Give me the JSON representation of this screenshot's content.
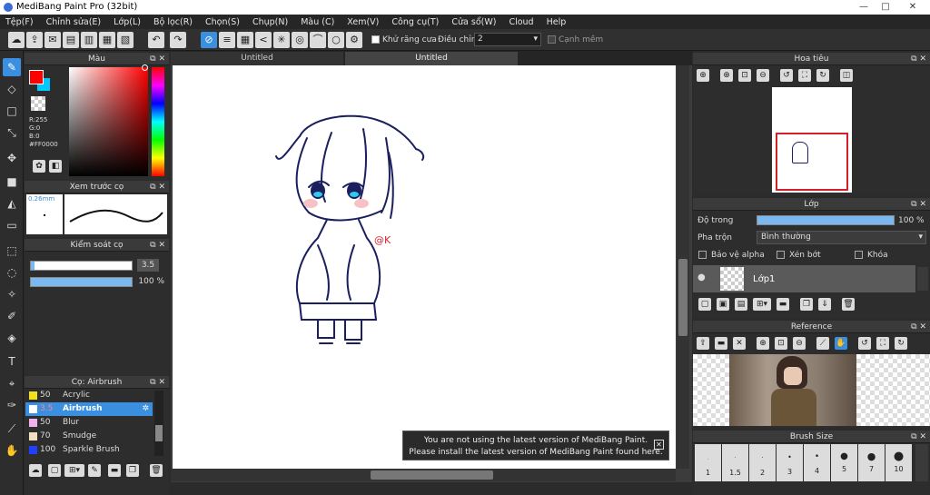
{
  "window": {
    "title": "MediBang Paint Pro (32bit)"
  },
  "menu": [
    "Tệp(F)",
    "Chỉnh sửa(E)",
    "Lớp(L)",
    "Bộ lọc(R)",
    "Chọn(S)",
    "Chụp(N)",
    "Màu (C)",
    "Xem(V)",
    "Công cụ(T)",
    "Cửa sổ(W)",
    "Cloud",
    "Help"
  ],
  "toolbar": {
    "antialias_label": "Khử răng cưa",
    "adjust_label": "Điều chỉnh",
    "adjust_value": "2",
    "smooth_label": "Cạnh mềm"
  },
  "color_panel": {
    "title": "Màu",
    "r": "R:255",
    "g": "G:0",
    "b": "B:0",
    "hex": "#FF0000",
    "primary": "#ff0000",
    "secondary": "#00c8ff"
  },
  "brush_preview": {
    "title": "Xem trước cọ",
    "size": "0.26mm"
  },
  "brush_control": {
    "title": "Kiểm soát cọ",
    "size_value": "3.5",
    "opacity_value": "100 %"
  },
  "brush_list": {
    "title": "Cọ: Airbrush",
    "items": [
      {
        "size": "50",
        "name": "Acrylic",
        "color": "#f0e020"
      },
      {
        "size": "3.5",
        "name": "Airbrush",
        "color": "#ffffff",
        "selected": true
      },
      {
        "size": "50",
        "name": "Blur",
        "color": "#f0b0f0"
      },
      {
        "size": "70",
        "name": "Smudge",
        "color": "#f0e0c0"
      },
      {
        "size": "100",
        "name": "Sparkle Brush",
        "color": "#2040ff"
      }
    ]
  },
  "tabs": [
    "Untitled",
    "Untitled"
  ],
  "canvas": {
    "signature": "@K"
  },
  "notice": {
    "line1": "You are not using the latest version of MediBang Paint.",
    "line2": "Please install the latest version of MediBang Paint found here."
  },
  "navigator": {
    "title": "Hoa tiêu"
  },
  "layer_panel": {
    "title": "Lớp",
    "opacity_label": "Độ trong",
    "opacity_value": "100 %",
    "blend_label": "Pha trộn",
    "blend_value": "Bình thường",
    "protect_alpha": "Bảo vệ alpha",
    "clipping": "Xén bớt",
    "lock": "Khóa",
    "layer_name": "Lớp1"
  },
  "reference": {
    "title": "Reference"
  },
  "brush_size": {
    "title": "Brush Size",
    "sizes": [
      "1",
      "1.5",
      "2",
      "3",
      "4",
      "5",
      "7",
      "10"
    ]
  }
}
